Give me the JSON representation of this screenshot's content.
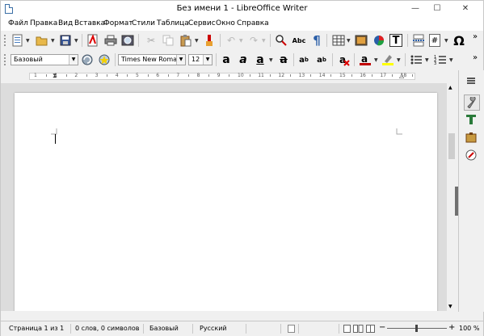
{
  "window": {
    "title": "Без имени 1 - LibreOffice Writer",
    "controls": {
      "minimize": "—",
      "maximize": "☐",
      "close": "✕"
    }
  },
  "menu": [
    "Файл",
    "Правка",
    "Вид",
    "Вставка",
    "Формат",
    "Стили",
    "Таблица",
    "Сервис",
    "Окно",
    "Справка"
  ],
  "formatting": {
    "paragraph_style": "Базовый",
    "font_name": "Times New Roman",
    "font_size": "12"
  },
  "toolbar_glyphs": {
    "spelling": "Abc",
    "pilcrow": "¶",
    "field": "#",
    "special_char": "Ω",
    "text_box": "T",
    "bold_a": "a",
    "overflow": "»"
  },
  "ruler": {
    "labels": [
      "1",
      "1",
      "2",
      "3",
      "4",
      "5",
      "6",
      "7",
      "8",
      "9",
      "10",
      "11",
      "12",
      "13",
      "14",
      "15",
      "16",
      "17",
      "18"
    ]
  },
  "statusbar": {
    "page": "Страница 1 из 1",
    "words": "0 слов, 0 символов",
    "style": "Базовый",
    "language": "Русский",
    "zoom": "100 %"
  },
  "colors": {
    "font_color": "#c00000",
    "highlight_color": "#ffff00",
    "accent_blue": "#2a5ea8"
  }
}
